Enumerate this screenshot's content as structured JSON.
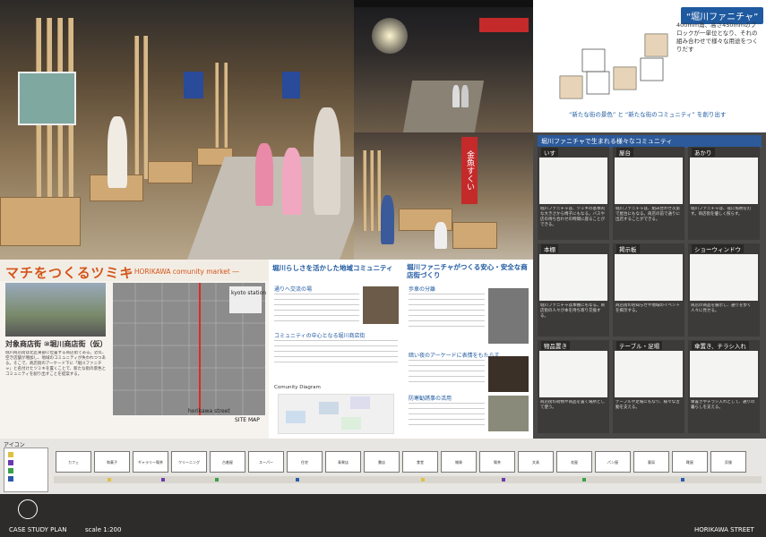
{
  "render_left": {
    "sign_red": "金魚すくい",
    "poster_text": "まちをつくるツミキ"
  },
  "panel_top_right": {
    "title": "“堀川ファニチャ”",
    "description": "400mm角、高さ450mmのブロックが一単位となり、それの組み合わせで様々な用途をつくりだす",
    "tagline_a": "“新たな街の景色”",
    "tagline_join": "と",
    "tagline_b": "“新たな街のコミュニティ”",
    "tagline_end": "を創り出す"
  },
  "furniture_grid": {
    "header": "堀川ファニチャで生まれる様々なコミュニティ",
    "cells": [
      {
        "label": "いす",
        "text": "堀川ファニチャは、ツミキの基本的な大きさから椅子にもなる。バスや店の待ち合わせの時間に座ることができる。"
      },
      {
        "label": "屋台",
        "text": "堀川ファニチャは、組み合わせ次第で屋台にもなる。商店の前で通りに出店することができる。"
      },
      {
        "label": "あかり",
        "text": "堀川ファニチャは、夜に照明を灯す。商店街を優しく照らす。"
      },
      {
        "label": "本棚",
        "text": "堀川ファニチャは本棚にもなる。商店街の人々が本を持ち寄り交換する。"
      },
      {
        "label": "掲示板",
        "text": "商店街のお知らせや地域のイベントを掲示する。"
      },
      {
        "label": "ショーウィンドウ",
        "text": "商店の商品を展示し、通りを歩く人々に見せる。"
      },
      {
        "label": "物品置き",
        "text": "商店街の荷物や商品を置く場所として使う。"
      },
      {
        "label": "テーブル・足場",
        "text": "テーブルや足場にもなり、様々な活動を支える。"
      },
      {
        "label": "傘置き、チラシ入れ",
        "text": "傘置きやチラシ入れとして、通りの暮らしを支える。"
      }
    ]
  },
  "middle_left": {
    "main_title": "マチをつくるツミキ",
    "sub_title": "― HORIKAWA comunity market ―",
    "store_name": "対象商店街 ⑩堀川商店街（仮）",
    "body_text": "堀川商店街は北区東部に位置する商店街である。近年、空き店舗が増加し、地域のコミュニティが失われつつある。そこで、商店街のアーケード下に「堀川ファニチャ」と名付けたツミキを置くことで、新たな街の景色とコミュニティを創り出すことを提案する。",
    "map_labels": [
      "horikawa street",
      "kyoto station",
      "SITE MAP"
    ]
  },
  "col_community": {
    "head": "堀川らしさを活かした地域コミュニティ",
    "sections": [
      "通りへ交流の場",
      "コミュニティの中心となる堀川商店街"
    ],
    "diagram_label": "Comunity Diagram"
  },
  "col_safety": {
    "head": "堀川ファニチャがつくる安心・安全な商店街づくり",
    "sections": [
      "歩車の分離",
      "暗い夜のアーケードに表情をもたらす",
      "防寒勧誘事の活用"
    ]
  },
  "bottom_strip": {
    "icon_label": "アイコン",
    "case_study": "CASE STUDY PLAN",
    "scale": "scale 1:200",
    "street_name": "HORIKAWA STREET",
    "shops": [
      "カフェ",
      "和菓子",
      "ギャラリー喫茶",
      "クリーニング",
      "古着屋",
      "スーパー",
      "住宅",
      "青果店",
      "書店",
      "食堂",
      "雑貨",
      "喫茶",
      "文具",
      "花屋",
      "パン屋",
      "薬局",
      "靴屋",
      "呉服"
    ]
  },
  "colors": {
    "accent_blue": "#1f5aa0",
    "accent_orange": "#d4541a",
    "wood": "#d8b98a"
  }
}
